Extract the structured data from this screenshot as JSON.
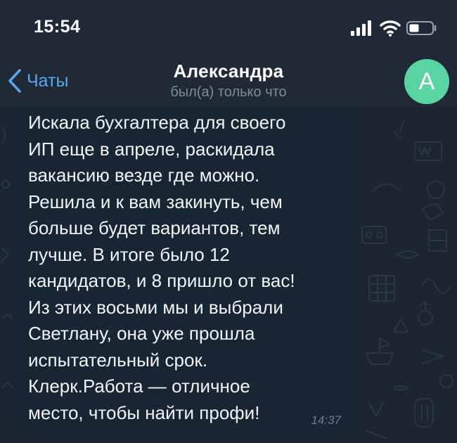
{
  "status_bar": {
    "time": "15:54",
    "icons": [
      "signal-icon",
      "wifi-icon",
      "battery-icon"
    ]
  },
  "header": {
    "back_label": "Чаты",
    "title": "Александра",
    "subtitle": "был(а) только что",
    "avatar_letter": "А",
    "avatar_color": "#5bd4a4"
  },
  "message": {
    "text": "Искала бухгалтера для своего\nИП еще в апреле, раскидала\nвакансию везде где можно.\nРешила и к вам закинуть, чем\nбольше будет вариантов, тем\nлучше. В итоге было 12\nкандидатов, и 8 пришло от вас!\nИз этих восьми мы и выбрали\nСветлану, она уже прошла\nиспытательный срок.\nКлерк.Работа — отличное\nместо, чтобы найти профи!",
    "time": "14:37"
  },
  "colors": {
    "accent": "#5aa7f2",
    "background": "#1b2631",
    "bubble": "#182533"
  }
}
